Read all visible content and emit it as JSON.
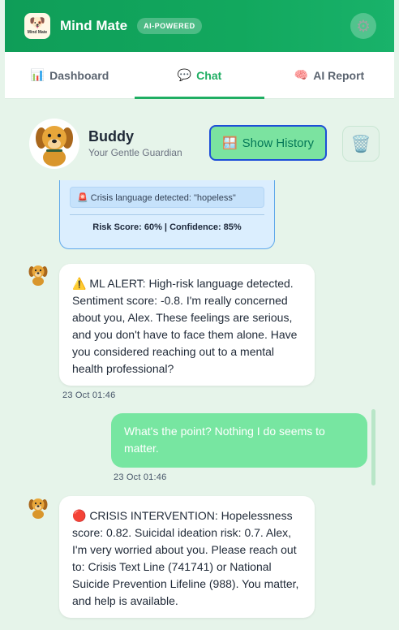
{
  "header": {
    "logo_text": "Mind Mate",
    "app_title": "Mind Mate",
    "badge": "AI-POWERED",
    "settings_icon": "gear-icon"
  },
  "tabs": [
    {
      "icon": "📊",
      "label": "Dashboard",
      "active": false
    },
    {
      "icon": "💬",
      "label": "Chat",
      "active": true
    },
    {
      "icon": "🧠",
      "label": "AI Report",
      "active": false
    }
  ],
  "companion": {
    "name": "Buddy",
    "subtitle": "Your Gentle Guardian",
    "history_icon": "🪟",
    "history_label": "Show History",
    "trash_icon": "🗑️"
  },
  "analysis_card": {
    "crisis_text": "🚨 Crisis language detected: \"hopeless\"",
    "risk_text": "Risk Score: 60% | Confidence: 85%"
  },
  "messages": [
    {
      "from": "bot",
      "text": "⚠️ ML ALERT: High-risk language detected. Sentiment score: -0.8. I'm really concerned about you, Alex. These feelings are serious, and you don't have to face them alone. Have you considered reaching out to a mental health professional?",
      "time": "23 Oct 01:46"
    },
    {
      "from": "user",
      "text": "What's the point? Nothing I do seems to matter.",
      "time": "23 Oct 01:46"
    },
    {
      "from": "bot",
      "text": "🔴 CRISIS INTERVENTION: Hopelessness score: 0.82. Suicidal ideation risk: 0.7. Alex, I'm very worried about you. Please reach out to: Crisis Text Line (741741) or National Suicide Prevention Lifeline (988). You matter, and help is available.",
      "time": ""
    }
  ],
  "colors": {
    "brand_green": "#0f9d58",
    "active_tab": "#1fae63",
    "user_bubble": "#77e6a1",
    "background": "#e6f4ea"
  }
}
